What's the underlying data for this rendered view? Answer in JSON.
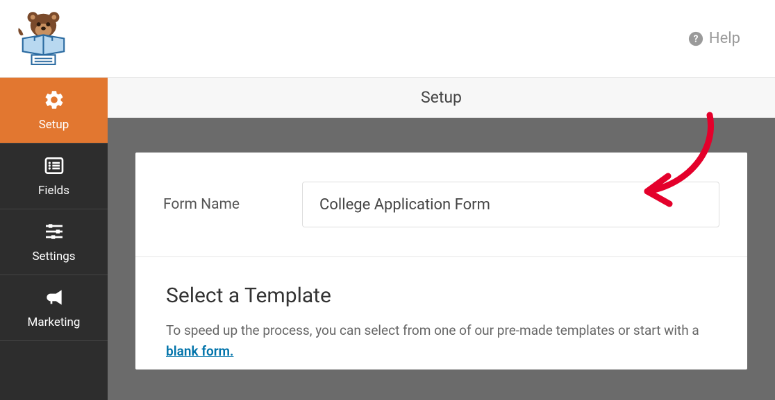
{
  "header": {
    "help_label": "Help"
  },
  "sidebar": {
    "items": [
      {
        "label": "Setup"
      },
      {
        "label": "Fields"
      },
      {
        "label": "Settings"
      },
      {
        "label": "Marketing"
      }
    ]
  },
  "content": {
    "title": "Setup",
    "form_name_label": "Form Name",
    "form_name_value": "College Application Form",
    "template_heading": "Select a Template",
    "template_desc_prefix": "To speed up the process, you can select from one of our pre-made templates or start with a ",
    "blank_form_text": "blank form."
  }
}
